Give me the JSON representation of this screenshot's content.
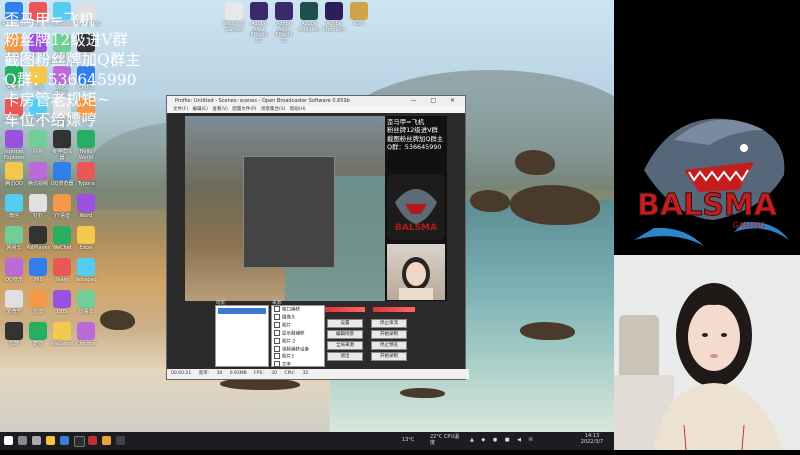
{
  "desktop": {
    "icons_col1": [
      "Administr...",
      "此电脑",
      "回收站",
      "控制面板",
      "Internet Explorer",
      "腾讯QQ",
      "微信",
      "网易云",
      "QQ音乐",
      "爱奇艺",
      "优酷"
    ],
    "icons_col2": [
      "WeGame",
      "计算机",
      "火绒",
      "Win10",
      "网易",
      "腾讯视频",
      "钉钉",
      "PotPlayer",
      "360",
      "迅雷",
      "酷狗"
    ],
    "icons_col3": [
      "WeGame",
      "Open Broadcast...",
      "WPS Office",
      "360浏览器",
      "夜神模拟器",
      "QQ浏览器",
      "YY语音",
      "WeChat",
      "Team",
      "OBS",
      "WeGame"
    ],
    "icons_col4": [
      "Photoshop",
      "OBS",
      "CPU-Z",
      "Steam",
      "Hello World",
      "Typora",
      "Word",
      "Excel",
      "Notepad",
      "记事本",
      "Chrome"
    ],
    "icons_top": [
      "Steam & Games",
      "Adobe After Effects CC",
      "Adobe After Effects CC",
      "Adobe Audition",
      "Adobe Premiere",
      "Rain"
    ]
  },
  "obs": {
    "title": "Profile: Untitled - Scenes: scenes - Open Broadcaster Software 0.659b",
    "menu": "文件(F) 编辑(E) 查看(V) 配置文件(P) 场景集合(S) 帮助(H)",
    "preview_text": "歪马甲=飞机\n粉丝牌12级进V群\n截图粉丝牌加Q群主\nQ群：536645990",
    "scenes_label": "场景:",
    "sources_label": "来源:",
    "sources": [
      "窗口捕获",
      "摄像头",
      "图片",
      "显示器捕获",
      "图片 2",
      "视频捕获设备",
      "图片3",
      "文本"
    ],
    "buttons": [
      "设置",
      "编辑场景",
      "全局来源",
      "退出",
      "停止串流",
      "开始录制",
      "停止预览",
      "开始录制"
    ],
    "status": "00:00:21  宽带: 30  0.93MB  FPS: 30  CPU: 32"
  },
  "taskbar": {
    "weather": "13°C",
    "cpu": "22°C CPU温度",
    "time": "14:13",
    "date": "2022/3/7"
  },
  "panel": {
    "lines": [
      "歪马甲=飞机",
      "粉丝牌12级进V群",
      "截图粉丝牌加Q群主",
      "Q群：536645990",
      "卡房管老规矩~",
      "车位不给嫖哼"
    ],
    "logo_text": "BALSMA",
    "logo_sub": "GAMING"
  },
  "colors": {
    "taskbar": "#1b1d22",
    "panel_bg": "#000000",
    "logo_red": "#c51d1d"
  }
}
